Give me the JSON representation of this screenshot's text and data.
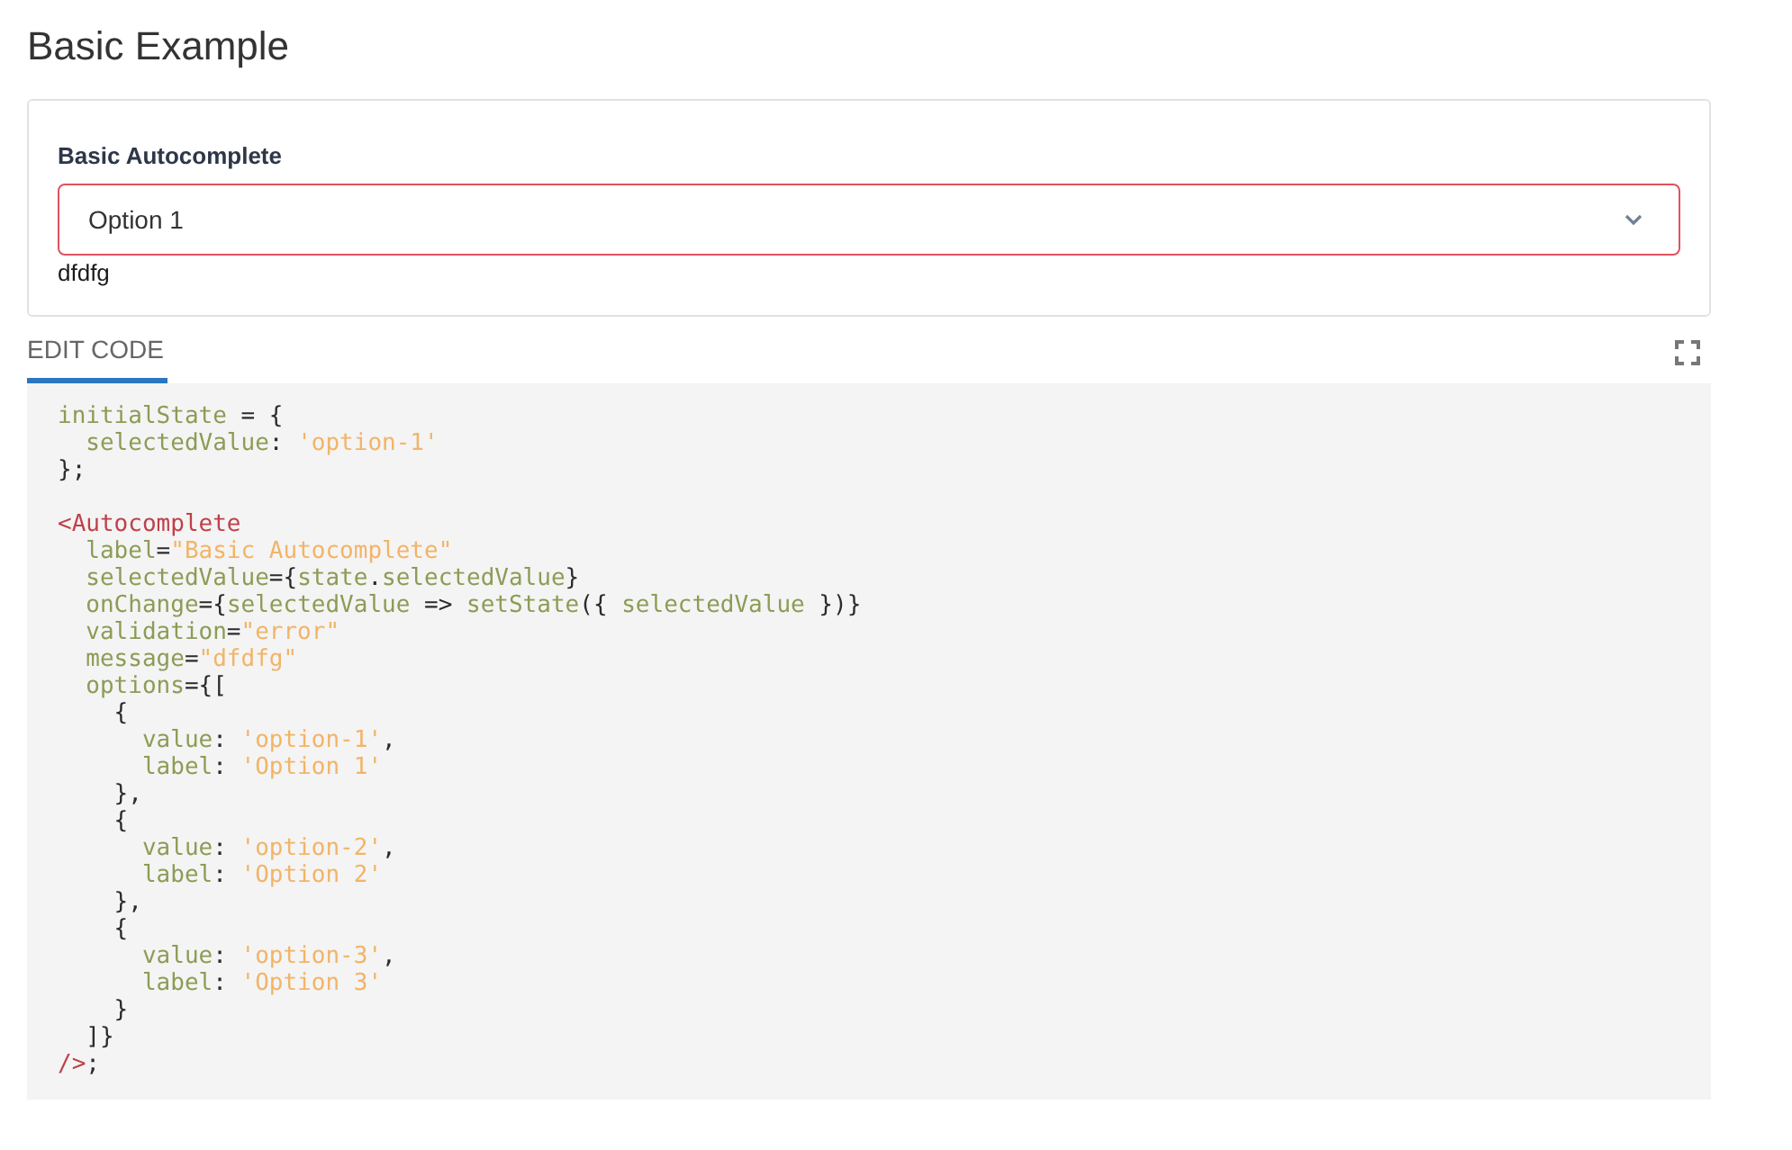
{
  "heading": {
    "title": "Basic Example"
  },
  "example_card": {
    "field": {
      "label": "Basic Autocomplete",
      "value": "Option 1",
      "invalid": true,
      "message": "dfdfg"
    }
  },
  "tabs": [
    {
      "label": "EDIT CODE",
      "selected": true
    }
  ],
  "code": {
    "blocks": [
      {
        "lines": [
          [
            {
              "kind": "name",
              "text": "initialState"
            },
            {
              "kind": "punct",
              "text": " = {"
            }
          ],
          [
            {
              "kind": "name",
              "text": "  selectedValue"
            },
            {
              "kind": "punct",
              "text": ": "
            },
            {
              "kind": "string",
              "text": "'option-1'"
            }
          ],
          [
            {
              "kind": "punct",
              "text": "};"
            }
          ]
        ]
      },
      {
        "lines": [
          [
            {
              "kind": "tag",
              "text": "<Autocomplete"
            }
          ],
          [
            {
              "kind": "name",
              "text": "  label"
            },
            {
              "kind": "punct",
              "text": "="
            },
            {
              "kind": "string",
              "text": "\"Basic Autocomplete\""
            }
          ],
          [
            {
              "kind": "name",
              "text": "  selectedValue"
            },
            {
              "kind": "punct",
              "text": "={"
            },
            {
              "kind": "name",
              "text": "state"
            },
            {
              "kind": "punct",
              "text": "."
            },
            {
              "kind": "name",
              "text": "selectedValue"
            },
            {
              "kind": "punct",
              "text": "}"
            }
          ],
          [
            {
              "kind": "name",
              "text": "  onChange"
            },
            {
              "kind": "punct",
              "text": "={"
            },
            {
              "kind": "name",
              "text": "selectedValue"
            },
            {
              "kind": "punct",
              "text": " => "
            },
            {
              "kind": "name",
              "text": "setState"
            },
            {
              "kind": "punct",
              "text": "({ "
            },
            {
              "kind": "name",
              "text": "selectedValue"
            },
            {
              "kind": "punct",
              "text": " })}"
            }
          ],
          [
            {
              "kind": "name",
              "text": "  validation"
            },
            {
              "kind": "punct",
              "text": "="
            },
            {
              "kind": "string",
              "text": "\"error\""
            }
          ],
          [
            {
              "kind": "name",
              "text": "  message"
            },
            {
              "kind": "punct",
              "text": "="
            },
            {
              "kind": "string",
              "text": "\"dfdfg\""
            }
          ],
          [
            {
              "kind": "name",
              "text": "  options"
            },
            {
              "kind": "punct",
              "text": "={["
            }
          ],
          [
            {
              "kind": "punct",
              "text": "    {"
            }
          ],
          [
            {
              "kind": "name",
              "text": "      value"
            },
            {
              "kind": "punct",
              "text": ": "
            },
            {
              "kind": "string",
              "text": "'option-1'"
            },
            {
              "kind": "punct",
              "text": ","
            }
          ],
          [
            {
              "kind": "name",
              "text": "      label"
            },
            {
              "kind": "punct",
              "text": ": "
            },
            {
              "kind": "string",
              "text": "'Option 1'"
            }
          ],
          [
            {
              "kind": "punct",
              "text": "    },"
            }
          ],
          [
            {
              "kind": "punct",
              "text": "    {"
            }
          ],
          [
            {
              "kind": "name",
              "text": "      value"
            },
            {
              "kind": "punct",
              "text": ": "
            },
            {
              "kind": "string",
              "text": "'option-2'"
            },
            {
              "kind": "punct",
              "text": ","
            }
          ],
          [
            {
              "kind": "name",
              "text": "      label"
            },
            {
              "kind": "punct",
              "text": ": "
            },
            {
              "kind": "string",
              "text": "'Option 2'"
            }
          ],
          [
            {
              "kind": "punct",
              "text": "    },"
            }
          ],
          [
            {
              "kind": "punct",
              "text": "    {"
            }
          ],
          [
            {
              "kind": "name",
              "text": "      value"
            },
            {
              "kind": "punct",
              "text": ": "
            },
            {
              "kind": "string",
              "text": "'option-3'"
            },
            {
              "kind": "punct",
              "text": ","
            }
          ],
          [
            {
              "kind": "name",
              "text": "      label"
            },
            {
              "kind": "punct",
              "text": ": "
            },
            {
              "kind": "string",
              "text": "'Option 3'"
            }
          ],
          [
            {
              "kind": "punct",
              "text": "    }"
            }
          ],
          [
            {
              "kind": "punct",
              "text": "  ]}"
            }
          ],
          [
            {
              "kind": "tag",
              "text": "/>"
            },
            {
              "kind": "punct",
              "text": ";"
            }
          ]
        ]
      }
    ]
  }
}
